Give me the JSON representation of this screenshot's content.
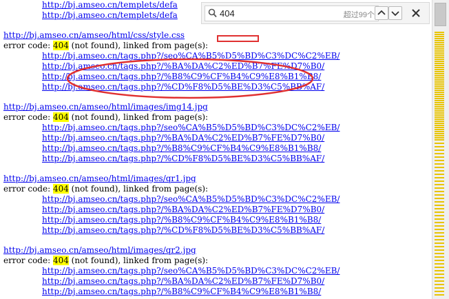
{
  "top_lines": [
    "http://bj.amseo.cn/templets/defa",
    "http://bj.amseo.cn/templets/defa"
  ],
  "blocks": [
    {
      "resource": "http://bj.amseo.cn/amseo/html/css/style.css",
      "prefix": "error code: ",
      "code": "404",
      "suffix": " (not found), linked from page(s):",
      "pages": [
        "http://bj.amseo.cn/tags.php?/seo%CA%B5%D5%BD%C3%DC%C2%EB/",
        "http://bj.amseo.cn/tags.php?/%BA%DA%C2%ED%B7%FE%D7%B0/",
        "http://bj.amseo.cn/tags.php?/%B8%C9%CF%B4%C9%E8%B1%B8/",
        "http://bj.amseo.cn/tags.php?/%CD%F8%D5%BE%D3%C5%BB%AF/"
      ]
    },
    {
      "resource": "http://bj.amseo.cn/amseo/html/images/img14.jpg",
      "prefix": "error code: ",
      "code": "404",
      "suffix": " (not found), linked from page(s):",
      "pages": [
        "http://bj.amseo.cn/tags.php?/seo%CA%B5%D5%BD%C3%DC%C2%EB/",
        "http://bj.amseo.cn/tags.php?/%BA%DA%C2%ED%B7%FE%D7%B0/",
        "http://bj.amseo.cn/tags.php?/%B8%C9%CF%B4%C9%E8%B1%B8/",
        "http://bj.amseo.cn/tags.php?/%CD%F8%D5%BE%D3%C5%BB%AF/"
      ]
    },
    {
      "resource": "http://bj.amseo.cn/amseo/html/images/qr1.jpg",
      "prefix": "error code: ",
      "code": "404",
      "suffix": " (not found), linked from page(s):",
      "pages": [
        "http://bj.amseo.cn/tags.php?/seo%CA%B5%D5%BD%C3%DC%C2%EB/",
        "http://bj.amseo.cn/tags.php?/%BA%DA%C2%ED%B7%FE%D7%B0/",
        "http://bj.amseo.cn/tags.php?/%B8%C9%CF%B4%C9%E8%B1%B8/",
        "http://bj.amseo.cn/tags.php?/%CD%F8%D5%BE%D3%C5%BB%AF/"
      ]
    },
    {
      "resource": "http://bj.amseo.cn/amseo/html/images/qr2.jpg",
      "prefix": "error code: ",
      "code": "404",
      "suffix": " (not found), linked from page(s):",
      "pages": [
        "http://bj.amseo.cn/tags.php?/seo%CA%B5%D5%BD%C3%DC%C2%EB/",
        "http://bj.amseo.cn/tags.php?/%BA%DA%C2%ED%B7%FE%D7%B0/",
        "http://bj.amseo.cn/tags.php?/%B8%C9%CF%B4%C9%E8%B1%B8/"
      ]
    }
  ],
  "find_bar": {
    "query": "404",
    "match_count": "超过99个",
    "icons": {
      "search": "search-icon",
      "up": "chevron-up-icon",
      "down": "chevron-down-icon",
      "close": "close-icon"
    }
  },
  "colors": {
    "link": "#0000ee",
    "highlight": "#ffff00",
    "annotation": "#e03030",
    "scroll_mark": "#e8c400"
  }
}
